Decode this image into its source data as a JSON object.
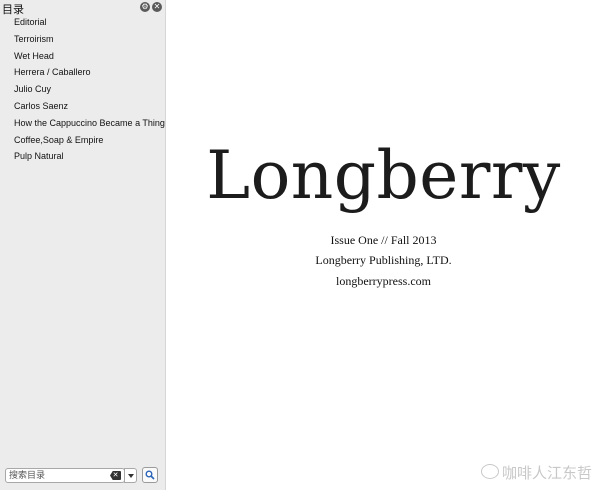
{
  "sidebar": {
    "title": "目录",
    "icons": [
      "settings-icon",
      "close-icon"
    ],
    "items": [
      {
        "label": "Editorial"
      },
      {
        "label": "Terroirism"
      },
      {
        "label": "Wet Head"
      },
      {
        "label": "Herrera / Caballero"
      },
      {
        "label": "Julio Cuy"
      },
      {
        "label": "Carlos Saenz"
      },
      {
        "label": "How the Cappuccino Became a Thing"
      },
      {
        "label": "Coffee,Soap & Empire"
      },
      {
        "label": "Pulp Natural"
      }
    ],
    "search": {
      "placeholder": "搜索目录",
      "value": ""
    }
  },
  "page": {
    "title": "Longberry",
    "issue": "Issue One // Fall 2013",
    "publisher": "Longberry Publishing, LTD.",
    "website": "longberrypress.com"
  },
  "watermark": {
    "text": "咖啡人江东哲"
  }
}
